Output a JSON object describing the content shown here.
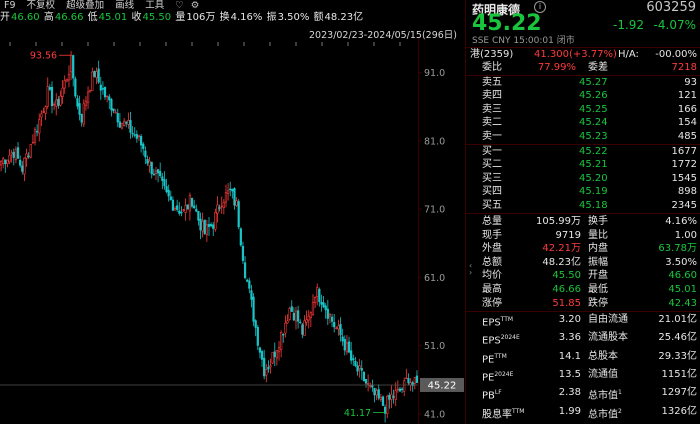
{
  "toolbar": {
    "f9": "F9",
    "items": [
      "不复权",
      "超级叠加",
      "画线",
      "工具"
    ],
    "icons": [
      "heart-icon",
      "gear-icon"
    ]
  },
  "top_stats": {
    "open_label": "开",
    "open": "46.60",
    "high_label": "高",
    "high": "46.66",
    "low_label": "低",
    "low": "45.01",
    "close_label": "收",
    "close": "45.50",
    "volume_label": "量",
    "volume": "106万",
    "turnover_label": "换",
    "turnover": "4.16%",
    "amplitude_label": "振",
    "amplitude": "3.50%",
    "amount_label": "额",
    "amount": "48.23亿"
  },
  "range_label": "2023/02/23-2024/05/15(296日)",
  "chart_data": {
    "type": "candlestick",
    "ylim": [
      39.5,
      95.5
    ],
    "y_ticks": [
      91.0,
      81.0,
      71.0,
      61.0,
      51.0,
      41.0
    ],
    "annotations": {
      "max_label": "93.56",
      "min_label": "41.17",
      "current_price": "45.22"
    },
    "colors": {
      "up": "#ff3b3b",
      "down": "#19c5c8",
      "axis": "#3a0000",
      "price_tag": "#5a5a5a"
    },
    "anchors": [
      [
        0,
        78.0
      ],
      [
        6,
        79.5
      ],
      [
        10,
        77.0
      ],
      [
        14,
        80.5
      ],
      [
        18,
        84.0
      ],
      [
        22,
        88.0
      ],
      [
        26,
        86.0
      ],
      [
        30,
        89.5
      ],
      [
        33,
        92.5
      ],
      [
        36,
        86.0
      ],
      [
        38,
        84.5
      ],
      [
        41,
        88.5
      ],
      [
        44,
        91.0
      ],
      [
        47,
        89.0
      ],
      [
        50,
        87.0
      ],
      [
        53,
        86.0
      ],
      [
        56,
        84.0
      ],
      [
        60,
        83.0
      ],
      [
        64,
        81.5
      ],
      [
        67,
        80.0
      ],
      [
        70,
        77.5
      ],
      [
        74,
        75.5
      ],
      [
        78,
        73.0
      ],
      [
        82,
        71.5
      ],
      [
        86,
        70.5
      ],
      [
        90,
        72.5
      ],
      [
        93,
        69.5
      ],
      [
        96,
        67.5
      ],
      [
        100,
        69.0
      ],
      [
        104,
        72.5
      ],
      [
        108,
        73.5
      ],
      [
        111,
        71.5
      ],
      [
        115,
        62.0
      ],
      [
        118,
        57.0
      ],
      [
        121,
        52.0
      ],
      [
        124,
        47.5
      ],
      [
        127,
        48.5
      ],
      [
        130,
        51.0
      ],
      [
        133,
        53.5
      ],
      [
        136,
        56.5
      ],
      [
        139,
        55.5
      ],
      [
        142,
        53.0
      ],
      [
        145,
        55.0
      ],
      [
        148,
        59.0
      ],
      [
        151,
        58.0
      ],
      [
        154,
        56.0
      ],
      [
        157,
        54.0
      ],
      [
        160,
        52.5
      ],
      [
        163,
        50.5
      ],
      [
        166,
        48.0
      ],
      [
        169,
        47.0
      ],
      [
        172,
        45.5
      ],
      [
        175,
        44.0
      ],
      [
        178,
        43.0
      ],
      [
        181,
        42.0
      ],
      [
        184,
        43.5
      ],
      [
        187,
        44.0
      ],
      [
        190,
        45.0
      ],
      [
        192,
        46.5
      ],
      [
        194,
        45.2
      ],
      [
        196,
        45.2
      ]
    ],
    "num_bars": 197
  },
  "quote": {
    "name": "药明康德",
    "code": "603259",
    "price": "45.22",
    "change": "-1.92",
    "change_pct": "-4.07%",
    "exchange": "SSE",
    "currency": "CNY",
    "time": "15:00:01",
    "status": "闭市",
    "hk_label": "港(2359)",
    "hk_price": "41.300(+3.77%)",
    "ha_label": "H/A:",
    "ha_value": "-00.00%",
    "ratio_label": "委比",
    "ratio": "77.99%",
    "diff_label": "委差",
    "diff": "7218",
    "asks": [
      {
        "label": "卖五",
        "price": "45.27",
        "vol": "93"
      },
      {
        "label": "卖四",
        "price": "45.26",
        "vol": "121"
      },
      {
        "label": "卖三",
        "price": "45.25",
        "vol": "166"
      },
      {
        "label": "卖二",
        "price": "45.24",
        "vol": "154"
      },
      {
        "label": "卖一",
        "price": "45.23",
        "vol": "485"
      }
    ],
    "bids": [
      {
        "label": "买一",
        "price": "45.22",
        "vol": "1677"
      },
      {
        "label": "买二",
        "price": "45.21",
        "vol": "1772"
      },
      {
        "label": "买三",
        "price": "45.20",
        "vol": "1545"
      },
      {
        "label": "买四",
        "price": "45.19",
        "vol": "898"
      },
      {
        "label": "买五",
        "price": "45.18",
        "vol": "2345"
      }
    ],
    "stats": [
      {
        "l1": "总量",
        "v1": "105.99万",
        "c1": "white",
        "l2": "换手",
        "v2": "4.16%",
        "c2": "white"
      },
      {
        "l1": "现手",
        "v1": "9719",
        "c1": "white",
        "l2": "量比",
        "v2": "1.00",
        "c2": "white"
      },
      {
        "l1": "外盘",
        "v1": "42.21万",
        "c1": "red",
        "l2": "内盘",
        "v2": "63.78万",
        "c2": "green"
      },
      {
        "l1": "总额",
        "v1": "48.23亿",
        "c1": "white",
        "l2": "振幅",
        "v2": "3.50%",
        "c2": "white"
      },
      {
        "l1": "均价",
        "v1": "45.50",
        "c1": "green",
        "l2": "开盘",
        "v2": "46.60",
        "c2": "green"
      },
      {
        "l1": "最高",
        "v1": "46.66",
        "c1": "green",
        "l2": "最低",
        "v2": "45.01",
        "c2": "green"
      },
      {
        "l1": "涨停",
        "v1": "51.85",
        "c1": "red",
        "l2": "跌停",
        "v2": "42.43",
        "c2": "green"
      }
    ],
    "fundamentals": [
      {
        "l1": "EPS",
        "s1": "TTM",
        "v1": "3.20",
        "l2": "自由流通",
        "v2": "21.01亿"
      },
      {
        "l1": "EPS",
        "s1": "2024E",
        "v1": "3.36",
        "l2": "流通股本",
        "v2": "25.46亿"
      },
      {
        "l1": "PE",
        "s1": "TTM",
        "v1": "14.1",
        "l2": "总股本",
        "v2": "29.33亿"
      },
      {
        "l1": "PE",
        "s1": "2024E",
        "v1": "13.5",
        "l2": "流通值",
        "v2": "1151亿"
      },
      {
        "l1": "PB",
        "s1": "LF",
        "v1": "2.38",
        "l2": "总市值",
        "s2": "1",
        "v2": "1297亿"
      },
      {
        "l1": "股息率",
        "s1": "TTM",
        "v1": "1.99",
        "l2": "总市值",
        "s2": "2",
        "v2": "1326亿"
      }
    ]
  }
}
